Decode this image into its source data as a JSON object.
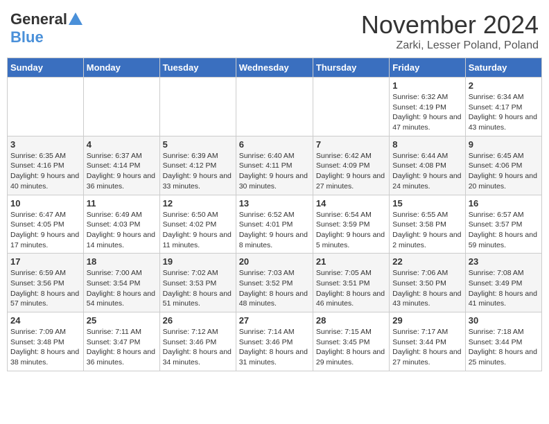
{
  "logo": {
    "general": "General",
    "blue": "Blue"
  },
  "header": {
    "month": "November 2024",
    "location": "Zarki, Lesser Poland, Poland"
  },
  "days_of_week": [
    "Sunday",
    "Monday",
    "Tuesday",
    "Wednesday",
    "Thursday",
    "Friday",
    "Saturday"
  ],
  "weeks": [
    [
      {
        "day": "",
        "info": ""
      },
      {
        "day": "",
        "info": ""
      },
      {
        "day": "",
        "info": ""
      },
      {
        "day": "",
        "info": ""
      },
      {
        "day": "",
        "info": ""
      },
      {
        "day": "1",
        "info": "Sunrise: 6:32 AM\nSunset: 4:19 PM\nDaylight: 9 hours and 47 minutes."
      },
      {
        "day": "2",
        "info": "Sunrise: 6:34 AM\nSunset: 4:17 PM\nDaylight: 9 hours and 43 minutes."
      }
    ],
    [
      {
        "day": "3",
        "info": "Sunrise: 6:35 AM\nSunset: 4:16 PM\nDaylight: 9 hours and 40 minutes."
      },
      {
        "day": "4",
        "info": "Sunrise: 6:37 AM\nSunset: 4:14 PM\nDaylight: 9 hours and 36 minutes."
      },
      {
        "day": "5",
        "info": "Sunrise: 6:39 AM\nSunset: 4:12 PM\nDaylight: 9 hours and 33 minutes."
      },
      {
        "day": "6",
        "info": "Sunrise: 6:40 AM\nSunset: 4:11 PM\nDaylight: 9 hours and 30 minutes."
      },
      {
        "day": "7",
        "info": "Sunrise: 6:42 AM\nSunset: 4:09 PM\nDaylight: 9 hours and 27 minutes."
      },
      {
        "day": "8",
        "info": "Sunrise: 6:44 AM\nSunset: 4:08 PM\nDaylight: 9 hours and 24 minutes."
      },
      {
        "day": "9",
        "info": "Sunrise: 6:45 AM\nSunset: 4:06 PM\nDaylight: 9 hours and 20 minutes."
      }
    ],
    [
      {
        "day": "10",
        "info": "Sunrise: 6:47 AM\nSunset: 4:05 PM\nDaylight: 9 hours and 17 minutes."
      },
      {
        "day": "11",
        "info": "Sunrise: 6:49 AM\nSunset: 4:03 PM\nDaylight: 9 hours and 14 minutes."
      },
      {
        "day": "12",
        "info": "Sunrise: 6:50 AM\nSunset: 4:02 PM\nDaylight: 9 hours and 11 minutes."
      },
      {
        "day": "13",
        "info": "Sunrise: 6:52 AM\nSunset: 4:01 PM\nDaylight: 9 hours and 8 minutes."
      },
      {
        "day": "14",
        "info": "Sunrise: 6:54 AM\nSunset: 3:59 PM\nDaylight: 9 hours and 5 minutes."
      },
      {
        "day": "15",
        "info": "Sunrise: 6:55 AM\nSunset: 3:58 PM\nDaylight: 9 hours and 2 minutes."
      },
      {
        "day": "16",
        "info": "Sunrise: 6:57 AM\nSunset: 3:57 PM\nDaylight: 8 hours and 59 minutes."
      }
    ],
    [
      {
        "day": "17",
        "info": "Sunrise: 6:59 AM\nSunset: 3:56 PM\nDaylight: 8 hours and 57 minutes."
      },
      {
        "day": "18",
        "info": "Sunrise: 7:00 AM\nSunset: 3:54 PM\nDaylight: 8 hours and 54 minutes."
      },
      {
        "day": "19",
        "info": "Sunrise: 7:02 AM\nSunset: 3:53 PM\nDaylight: 8 hours and 51 minutes."
      },
      {
        "day": "20",
        "info": "Sunrise: 7:03 AM\nSunset: 3:52 PM\nDaylight: 8 hours and 48 minutes."
      },
      {
        "day": "21",
        "info": "Sunrise: 7:05 AM\nSunset: 3:51 PM\nDaylight: 8 hours and 46 minutes."
      },
      {
        "day": "22",
        "info": "Sunrise: 7:06 AM\nSunset: 3:50 PM\nDaylight: 8 hours and 43 minutes."
      },
      {
        "day": "23",
        "info": "Sunrise: 7:08 AM\nSunset: 3:49 PM\nDaylight: 8 hours and 41 minutes."
      }
    ],
    [
      {
        "day": "24",
        "info": "Sunrise: 7:09 AM\nSunset: 3:48 PM\nDaylight: 8 hours and 38 minutes."
      },
      {
        "day": "25",
        "info": "Sunrise: 7:11 AM\nSunset: 3:47 PM\nDaylight: 8 hours and 36 minutes."
      },
      {
        "day": "26",
        "info": "Sunrise: 7:12 AM\nSunset: 3:46 PM\nDaylight: 8 hours and 34 minutes."
      },
      {
        "day": "27",
        "info": "Sunrise: 7:14 AM\nSunset: 3:46 PM\nDaylight: 8 hours and 31 minutes."
      },
      {
        "day": "28",
        "info": "Sunrise: 7:15 AM\nSunset: 3:45 PM\nDaylight: 8 hours and 29 minutes."
      },
      {
        "day": "29",
        "info": "Sunrise: 7:17 AM\nSunset: 3:44 PM\nDaylight: 8 hours and 27 minutes."
      },
      {
        "day": "30",
        "info": "Sunrise: 7:18 AM\nSunset: 3:44 PM\nDaylight: 8 hours and 25 minutes."
      }
    ]
  ]
}
